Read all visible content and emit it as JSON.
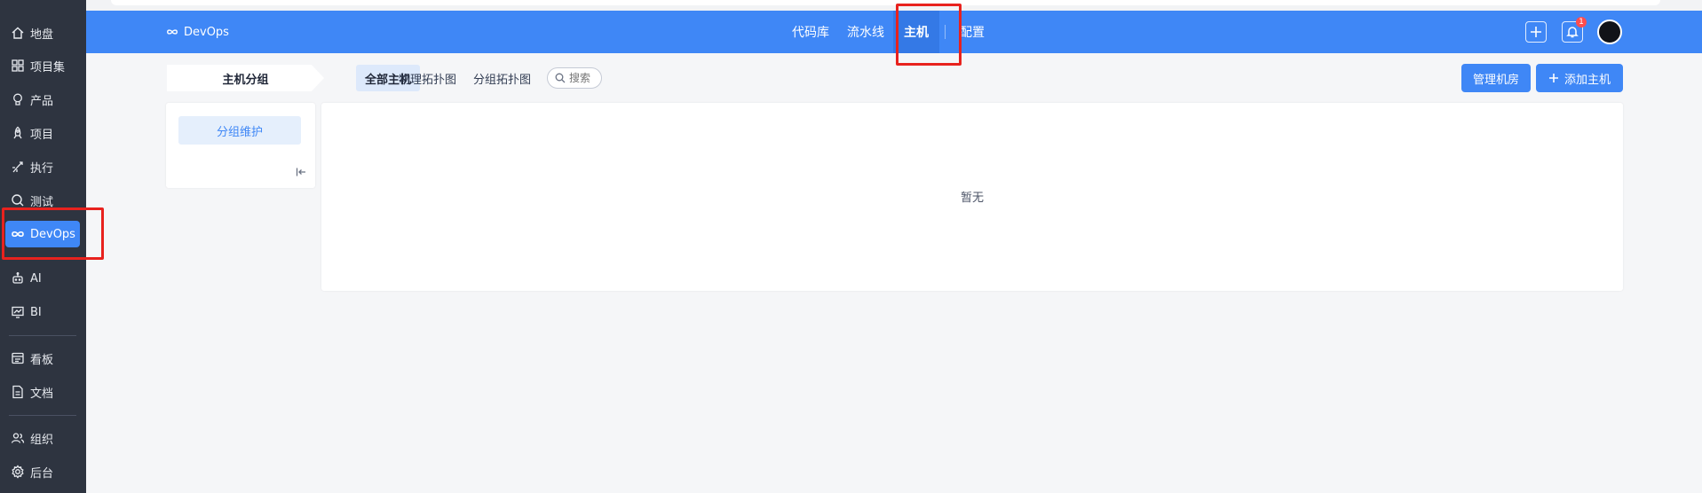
{
  "sidebar": {
    "items": [
      {
        "label": "地盘",
        "icon": "home-icon"
      },
      {
        "label": "项目集",
        "icon": "grid-icon"
      },
      {
        "label": "产品",
        "icon": "lightbulb-icon"
      },
      {
        "label": "项目",
        "icon": "rocket-icon"
      },
      {
        "label": "执行",
        "icon": "run-icon"
      },
      {
        "label": "测试",
        "icon": "search-bug-icon"
      },
      {
        "label": "DevOps",
        "icon": "infinity-icon",
        "active": true
      },
      {
        "label": "AI",
        "icon": "robot-icon"
      },
      {
        "label": "BI",
        "icon": "chart-icon"
      },
      {
        "label": "看板",
        "icon": "kanban-icon"
      },
      {
        "label": "文档",
        "icon": "document-icon"
      },
      {
        "label": "组织",
        "icon": "users-icon"
      },
      {
        "label": "后台",
        "icon": "gear-icon"
      }
    ]
  },
  "header": {
    "brand": "DevOps",
    "nav": [
      "代码库",
      "流水线",
      "主机",
      "配置"
    ],
    "active_nav": "主机",
    "notification_count": "1"
  },
  "toolbar": {
    "group_tab": "主机分组",
    "view_tabs": [
      "全部主机",
      "物理拓扑图",
      "分组拓扑图"
    ],
    "search_label": "搜索",
    "manage_room_label": "管理机房",
    "add_host_label": "添加主机"
  },
  "left_panel": {
    "group_maintenance_label": "分组维护"
  },
  "main_panel": {
    "empty_text": "暂无"
  },
  "colors": {
    "primary": "#3f87f6",
    "sidebar_bg": "#2e3440",
    "annotation": "#e8221e"
  }
}
